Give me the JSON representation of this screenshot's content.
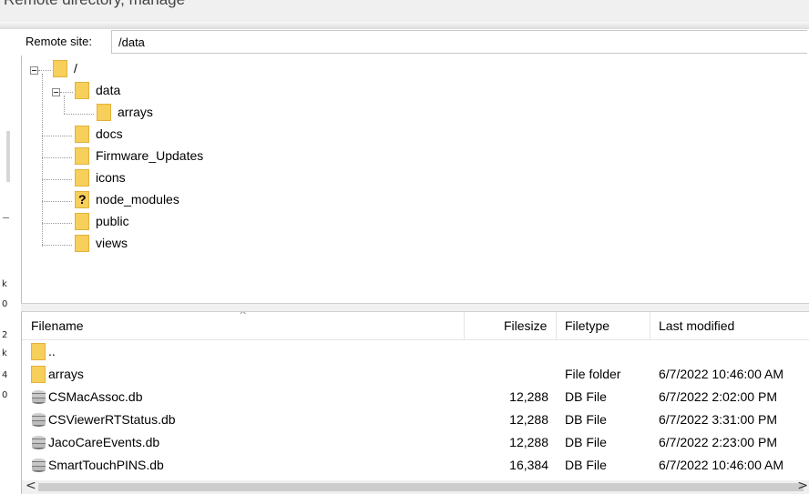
{
  "window": {
    "partial_title": "Remote directory, manage"
  },
  "left_strip": {
    "glyphs": [
      "k",
      "0",
      "2",
      "k",
      "4",
      "0"
    ]
  },
  "remote_site": {
    "label": "Remote site:",
    "path": "/data"
  },
  "tree": {
    "root_label": "/",
    "nodes": [
      {
        "label": "data",
        "status": "expanded"
      },
      {
        "label": "arrays",
        "status": "normal"
      },
      {
        "label": "docs",
        "status": "normal"
      },
      {
        "label": "Firmware_Updates",
        "status": "normal"
      },
      {
        "label": "icons",
        "status": "normal"
      },
      {
        "label": "node_modules",
        "status": "unknown"
      },
      {
        "label": "public",
        "status": "normal"
      },
      {
        "label": "views",
        "status": "normal"
      }
    ]
  },
  "file_list": {
    "columns": {
      "filename": "Filename",
      "filesize": "Filesize",
      "filetype": "Filetype",
      "modified": "Last modified"
    },
    "rows": [
      {
        "name": "..",
        "size": "",
        "type": "",
        "modified": "",
        "icon": "folder-icon"
      },
      {
        "name": "arrays",
        "size": "",
        "type": "File folder",
        "modified": "6/7/2022 10:46:00 AM",
        "icon": "folder-icon"
      },
      {
        "name": "CSMacAssoc.db",
        "size": "12,288",
        "type": "DB File",
        "modified": "6/7/2022 2:02:00 PM",
        "icon": "database-icon"
      },
      {
        "name": "CSViewerRTStatus.db",
        "size": "12,288",
        "type": "DB File",
        "modified": "6/7/2022 3:31:00 PM",
        "icon": "database-icon"
      },
      {
        "name": "JacoCareEvents.db",
        "size": "12,288",
        "type": "DB File",
        "modified": "6/7/2022 2:23:00 PM",
        "icon": "database-icon"
      },
      {
        "name": "SmartTouchPINS.db",
        "size": "16,384",
        "type": "DB File",
        "modified": "6/7/2022 10:46:00 AM",
        "icon": "database-icon"
      }
    ]
  },
  "scrollbar": {
    "left_arrow": "<",
    "right_arrow": ">"
  },
  "colors": {
    "folder": "#f7cf5b",
    "chrome": "#f0f0f0"
  }
}
